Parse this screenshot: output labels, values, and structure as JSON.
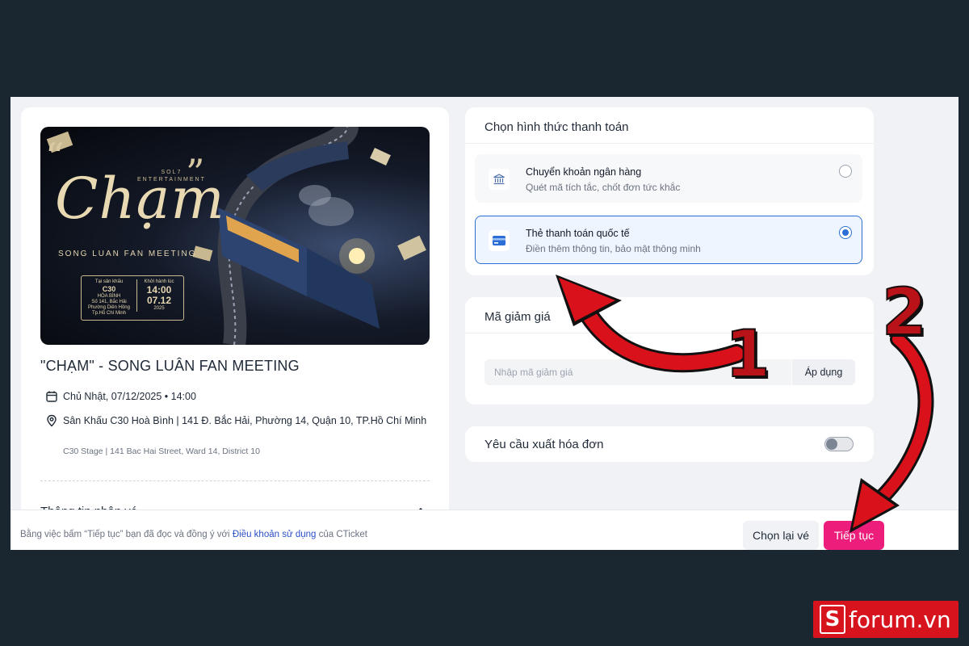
{
  "poster": {
    "brand_line1": "SOL7",
    "brand_line2": "ENTERTAINMENT",
    "title": "Chạm",
    "subtitle": "SONG LUAN FAN MEETING",
    "ticket_venue_label": "Tại sân khấu",
    "ticket_venue": "C30",
    "ticket_venue2": "HÒA BÌNH",
    "ticket_addr1": "Số 141, Bắc Hải",
    "ticket_addr2": "Phường Diên Hồng",
    "ticket_addr3": "Tp.Hồ Chí Minh",
    "ticket_time_label": "Khởi hành lúc",
    "ticket_time": "14:00",
    "ticket_date": "07.12",
    "ticket_year": "2025"
  },
  "event": {
    "title": "\"CHẠM\" - SONG LUÂN FAN MEETING",
    "datetime": "Chủ Nhật, 07/12/2025 • 14:00",
    "venue": "Sân Khấu C30 Hoà Bình | 141 Đ. Bắc Hải, Phường 14, Quận 10, TP.Hồ Chí Minh",
    "venue_en": "C30 Stage | 141 Bac Hai Street, Ward 14, District 10",
    "recipient_section": "Thông tin nhận vé"
  },
  "payment": {
    "title": "Chọn hình thức thanh toán",
    "options": [
      {
        "name": "Chuyển khoản ngân hàng",
        "desc": "Quét mã tích tắc, chốt đơn tức khắc",
        "icon": "bank-icon",
        "selected": false
      },
      {
        "name": "Thẻ thanh toán quốc tế",
        "desc": "Điền thêm thông tin, bảo mật thông minh",
        "icon": "card-icon",
        "selected": true
      }
    ]
  },
  "coupon": {
    "title": "Mã giảm giá",
    "placeholder": "Nhập mã giảm giá",
    "apply_label": "Áp dụng"
  },
  "invoice": {
    "label": "Yêu cầu xuất hóa đơn",
    "enabled": false
  },
  "footer": {
    "terms_prefix": "Bằng việc bấm “Tiếp tục” bạn đã đọc và đồng ý với",
    "terms_link": "Điều khoản sử dụng",
    "terms_suffix": "của CTicket",
    "back_label": "Chọn lại vé",
    "next_label": "Tiếp tục"
  },
  "annotations": {
    "step1": "1",
    "step2": "2",
    "arrow_color": "#d8111b"
  },
  "watermark": {
    "letter": "S",
    "text": "forum.vn"
  },
  "colors": {
    "accent": "#ec1d7b",
    "selected": "#2b6fd6",
    "backdrop": "#1b2730"
  }
}
